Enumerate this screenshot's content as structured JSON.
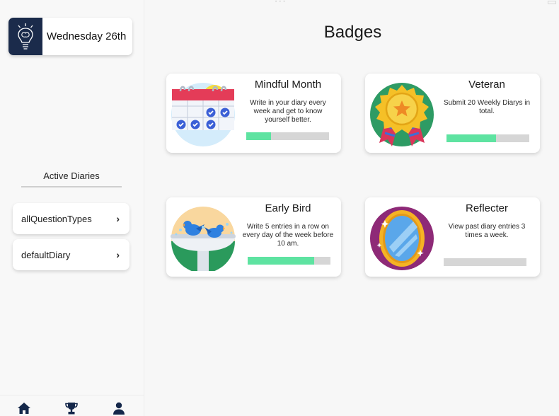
{
  "sidebar": {
    "date_label": "Wednesday 26th",
    "active_title": "Active Diaries",
    "diaries": [
      {
        "label": "allQuestionTypes"
      },
      {
        "label": "defaultDiary"
      }
    ],
    "chevron": "›",
    "nav_icons": [
      "home-icon",
      "trophy-icon",
      "person-icon"
    ]
  },
  "main": {
    "title": "Badges"
  },
  "badges": [
    {
      "title": "Mindful Month",
      "description": "Write in your diary every week and get to know yourself better.",
      "progress": 0.3,
      "icon": "calendar-icon"
    },
    {
      "title": "Veteran",
      "description": "Submit 20 Weekly Diarys in total.",
      "progress": 0.6,
      "icon": "medal-icon"
    },
    {
      "title": "Early Bird",
      "description": "Write 5 entries in a row on every day of the week before 10 am.",
      "progress": 0.8,
      "icon": "birdbath-icon"
    },
    {
      "title": "Reflecter",
      "description": "View past diary entries 3 times a week.",
      "progress": 0.0,
      "icon": "mirror-icon"
    }
  ],
  "colors": {
    "progress_fill": "#5ee3a1",
    "progress_track": "#d6d6d6",
    "nav_icon": "#14274a",
    "logo_bg": "#1b2b4b"
  }
}
